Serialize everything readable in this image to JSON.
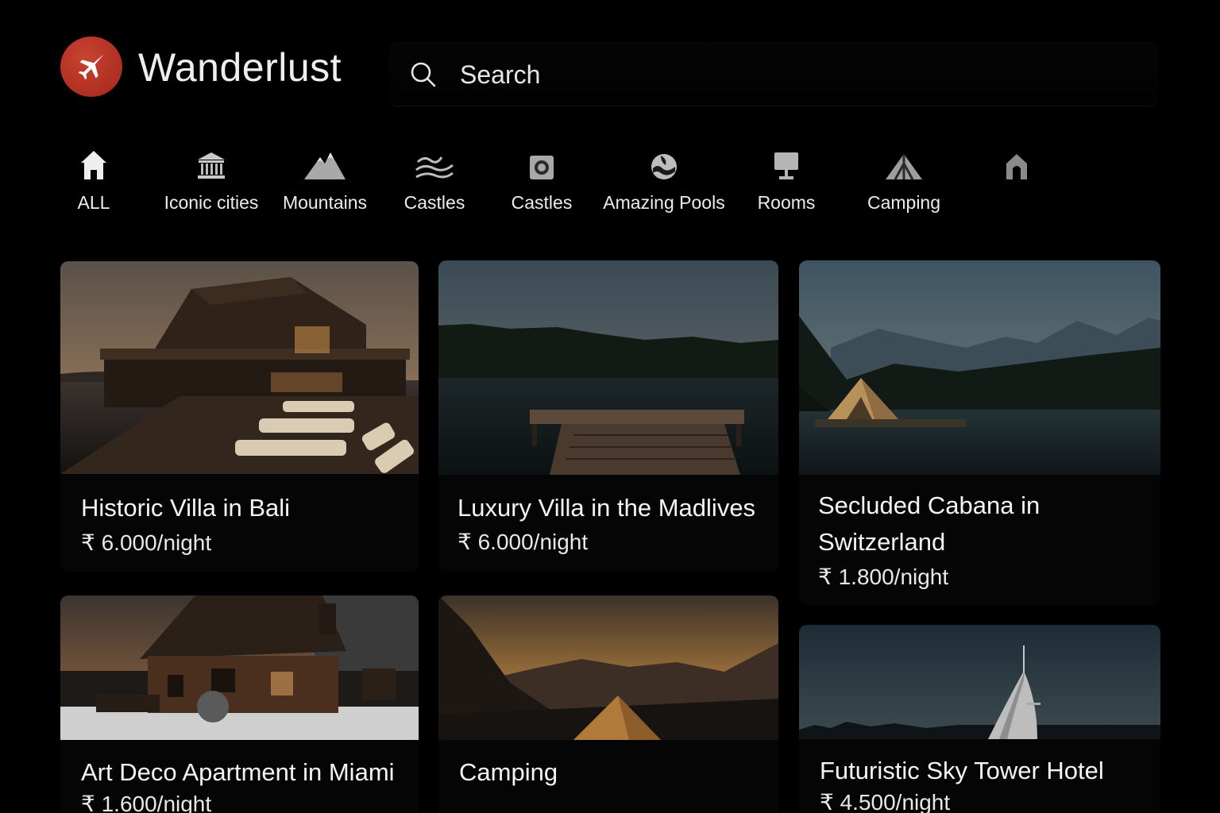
{
  "header": {
    "brand": "Wanderlust",
    "search_placeholder": "Search"
  },
  "categories": [
    {
      "label": "ALL",
      "icon": "house-icon"
    },
    {
      "label": "Iconic cities",
      "icon": "landmark-icon"
    },
    {
      "label": "Mountains",
      "icon": "mountain-icon"
    },
    {
      "label": "Castles",
      "icon": "waves-icon"
    },
    {
      "label": "Castles",
      "icon": "camera-icon"
    },
    {
      "label": "Amazing Pools",
      "icon": "pool-icon"
    },
    {
      "label": "Rooms",
      "icon": "monitor-icon"
    },
    {
      "label": "Camping",
      "icon": "tent-icon"
    },
    {
      "label": "",
      "icon": "arch-icon"
    }
  ],
  "listings": [
    {
      "title": "Historic Villa in Bali",
      "price": "₹ 6.000/night"
    },
    {
      "title": "Luxury Villa in the Madlives",
      "price": "₹ 6.000/night"
    },
    {
      "title_line1": "Secluded Cabana in",
      "title_line2": "Switzerland",
      "price": "₹ 1.800/night"
    },
    {
      "title": "Art Deco Apartment in Miami",
      "price": "₹ 1.600/night"
    },
    {
      "title": "Camping",
      "price": ""
    },
    {
      "title": "Futuristic Sky Tower Hotel",
      "price": "₹ 4.500/night"
    }
  ],
  "colors": {
    "background": "#000000",
    "logo": "#b0301f"
  }
}
